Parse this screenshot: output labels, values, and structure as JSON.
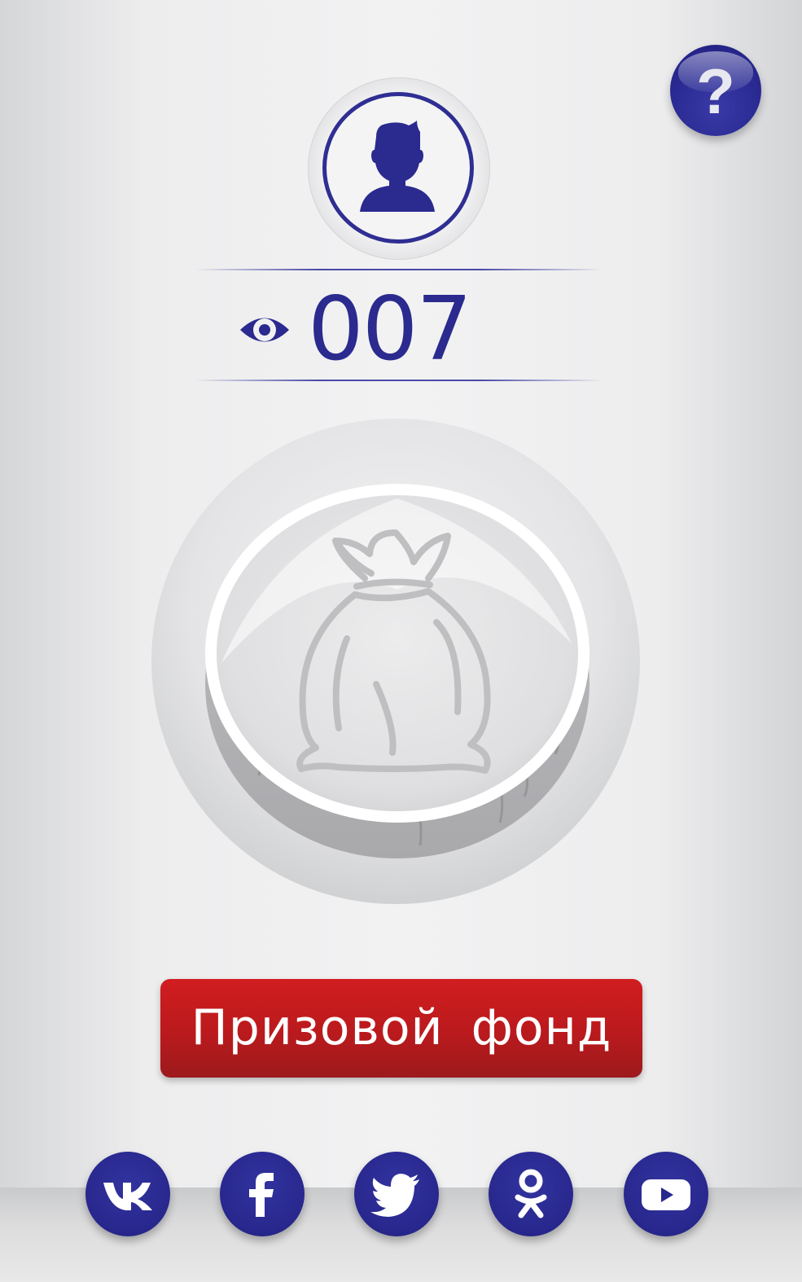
{
  "help": {
    "label": "?",
    "icon": "question-icon"
  },
  "profile": {
    "icon": "user-avatar-icon"
  },
  "views": {
    "icon": "eye-icon",
    "count": "007"
  },
  "prize": {
    "icon": "money-bag-icon",
    "button_label": "Призовой  фонд"
  },
  "social": [
    {
      "name": "vk",
      "icon": "vk-icon"
    },
    {
      "name": "facebook",
      "icon": "facebook-icon"
    },
    {
      "name": "twitter",
      "icon": "twitter-icon"
    },
    {
      "name": "odnoklassniki",
      "icon": "odnoklassniki-icon"
    },
    {
      "name": "youtube",
      "icon": "youtube-icon"
    }
  ],
  "colors": {
    "primary": "#2a2a8f",
    "button_red": "#c01b1e",
    "background": "#eeeeef"
  }
}
